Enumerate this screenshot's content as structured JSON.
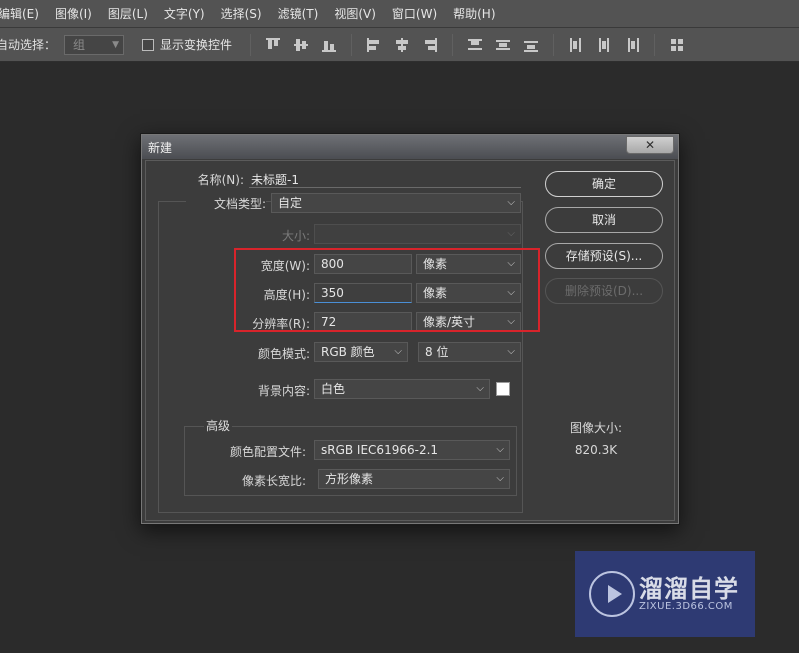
{
  "menubar": {
    "items": [
      "编辑(E)",
      "图像(I)",
      "图层(L)",
      "文字(Y)",
      "选择(S)",
      "滤镜(T)",
      "视图(V)",
      "窗口(W)",
      "帮助(H)"
    ]
  },
  "options": {
    "auto_select_label": "自动选择：",
    "auto_select_value": "组",
    "show_transform_label": "显示变换控件"
  },
  "dialog": {
    "title": "新建",
    "close_label": "✕",
    "name_label": "名称(N):",
    "name_value": "未标题-1",
    "doc_type_label": "文档类型:",
    "doc_type_value": "自定",
    "size_label": "大小:",
    "size_value": "",
    "width_label": "宽度(W):",
    "width_value": "800",
    "width_unit": "像素",
    "height_label": "高度(H):",
    "height_value": "350",
    "height_unit": "像素",
    "resolution_label": "分辨率(R):",
    "resolution_value": "72",
    "resolution_unit": "像素/英寸",
    "color_mode_label": "颜色模式:",
    "color_mode_value": "RGB 颜色",
    "bit_depth_value": "8 位",
    "background_label": "背景内容:",
    "background_value": "白色",
    "advanced_title": "高级",
    "color_profile_label": "颜色配置文件:",
    "color_profile_value": "sRGB IEC61966-2.1",
    "pixel_aspect_label": "像素长宽比:",
    "pixel_aspect_value": "方形像素",
    "ok_label": "确定",
    "cancel_label": "取消",
    "save_preset_label": "存储预设(S)...",
    "delete_preset_label": "删除预设(D)...",
    "image_size_label": "图像大小:",
    "image_size_value": "820.3K"
  },
  "watermark": {
    "brand": "溜溜自学",
    "url": "ZIXUE.3D66.COM"
  }
}
